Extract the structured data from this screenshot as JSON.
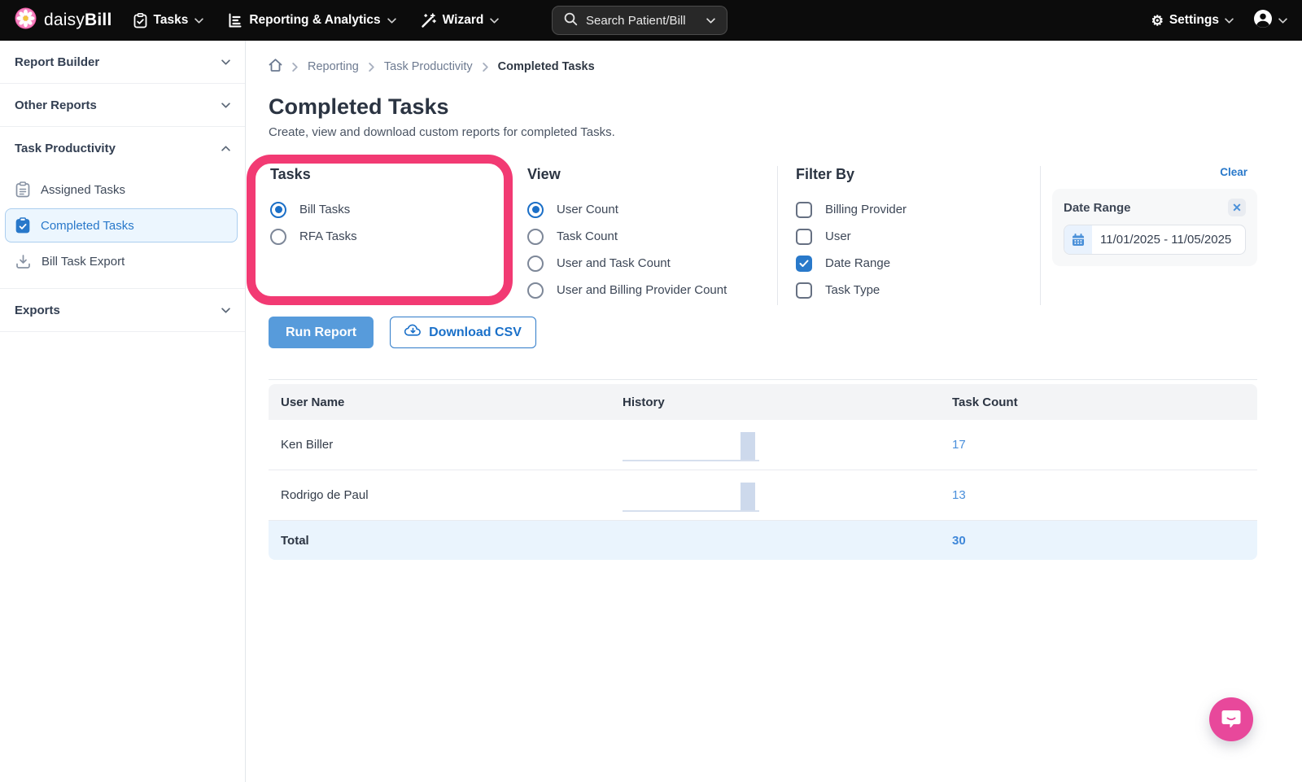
{
  "navbar": {
    "brand": {
      "daisy": "daisy",
      "bill": "Bill"
    },
    "menus": [
      {
        "label": "Tasks",
        "icon": "clipboard-icon"
      },
      {
        "label": "Reporting & Analytics",
        "icon": "bar-chart-icon"
      },
      {
        "label": "Wizard",
        "icon": "wand-icon"
      }
    ],
    "search": {
      "placeholder": "Search Patient/Bill",
      "icon": "search-icon"
    },
    "settings_label": "Settings"
  },
  "sidebar": {
    "sections": [
      {
        "label": "Report Builder",
        "state": "collapsed"
      },
      {
        "label": "Other Reports",
        "state": "collapsed"
      },
      {
        "label": "Task Productivity",
        "state": "expanded"
      },
      {
        "label": "Exports",
        "state": "collapsed"
      }
    ],
    "task_productivity_items": [
      {
        "label": "Assigned Tasks",
        "icon": "clipboard-list-icon",
        "active": false
      },
      {
        "label": "Completed Tasks",
        "icon": "clipboard-check-icon",
        "active": true
      },
      {
        "label": "Bill Task Export",
        "icon": "download-tray-icon",
        "active": false
      }
    ]
  },
  "breadcrumb": {
    "links": [
      "Reporting",
      "Task Productivity"
    ],
    "current": "Completed Tasks"
  },
  "page": {
    "title": "Completed Tasks",
    "subtitle": "Create, view and download custom reports for completed Tasks."
  },
  "filters": {
    "tasks": {
      "heading": "Tasks",
      "options": [
        {
          "label": "Bill Tasks",
          "selected": true
        },
        {
          "label": "RFA Tasks",
          "selected": false
        }
      ]
    },
    "view": {
      "heading": "View",
      "options": [
        {
          "label": "User Count",
          "selected": true
        },
        {
          "label": "Task Count",
          "selected": false
        },
        {
          "label": "User and Task Count",
          "selected": false
        },
        {
          "label": "User and Billing Provider Count",
          "selected": false
        }
      ]
    },
    "filter_by": {
      "heading": "Filter By",
      "options": [
        {
          "label": "Billing Provider",
          "checked": false
        },
        {
          "label": "User",
          "checked": false
        },
        {
          "label": "Date Range",
          "checked": true
        },
        {
          "label": "Task Type",
          "checked": false
        }
      ]
    },
    "clear_label": "Clear",
    "date_range": {
      "label": "Date Range",
      "value": "11/01/2025 - 11/05/2025"
    }
  },
  "actions": {
    "run_report": "Run Report",
    "download_csv": "Download CSV"
  },
  "table": {
    "columns": [
      "User Name",
      "History",
      "Task Count"
    ],
    "rows": [
      {
        "user": "Ken Biller",
        "count": "17",
        "history": "single-bar-sparkline"
      },
      {
        "user": "Rodrigo de Paul",
        "count": "13",
        "history": "single-bar-sparkline"
      }
    ],
    "total": {
      "label": "Total",
      "count": "30"
    }
  },
  "colors": {
    "accent_blue": "#2878ca",
    "run_button_blue": "#579bdb",
    "link_blue": "#4a8fdb",
    "highlight_pink": "#f23a73",
    "brand_pink": "#ee4d9b",
    "selected_item_bg": "#ecf6fe",
    "checked_checkbox": "#2979ca",
    "navbar_bg": "#0c0c0c"
  }
}
